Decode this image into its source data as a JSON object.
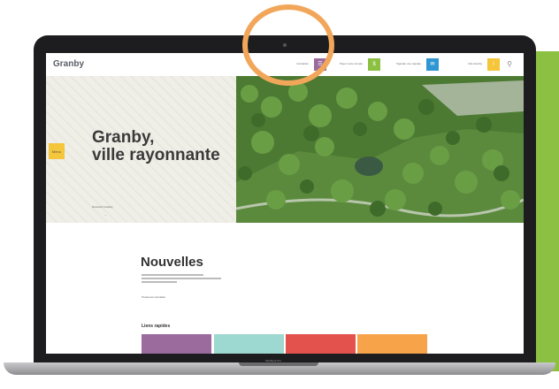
{
  "site": {
    "logo": "Granby",
    "nav": [
      {
        "label": "Inscription",
        "color": "#9b6b9e",
        "glyph": "☰"
      },
      {
        "label": "Payer votre compte",
        "color": "#8cc043",
        "glyph": "$"
      },
      {
        "label": "Signaler une requête",
        "color": "#2e97d1",
        "glyph": "✉"
      },
      {
        "label": "Info-Granby",
        "color": "#f5c53a",
        "glyph": "i"
      }
    ],
    "search_icon": "search-icon"
  },
  "hero": {
    "title_line1": "Granby,",
    "title_line2": "ville rayonnante",
    "arrow_label": "Menu",
    "link_text": "Découvrir Granby",
    "scroll_glyph": "⌄"
  },
  "news": {
    "title": "Nouvelles",
    "link_text": "Toutes les nouvelles"
  },
  "quick_links": {
    "title": "Liens rapides",
    "tiles": [
      {
        "color": "#9b6b9e"
      },
      {
        "color": "#9ed9d1"
      },
      {
        "color": "#e4524e"
      },
      {
        "color": "#f6a34a"
      }
    ]
  },
  "device": {
    "label": "MacBook Pro",
    "panel_color": "#8cc043",
    "ring_color": "#f2a65a"
  }
}
